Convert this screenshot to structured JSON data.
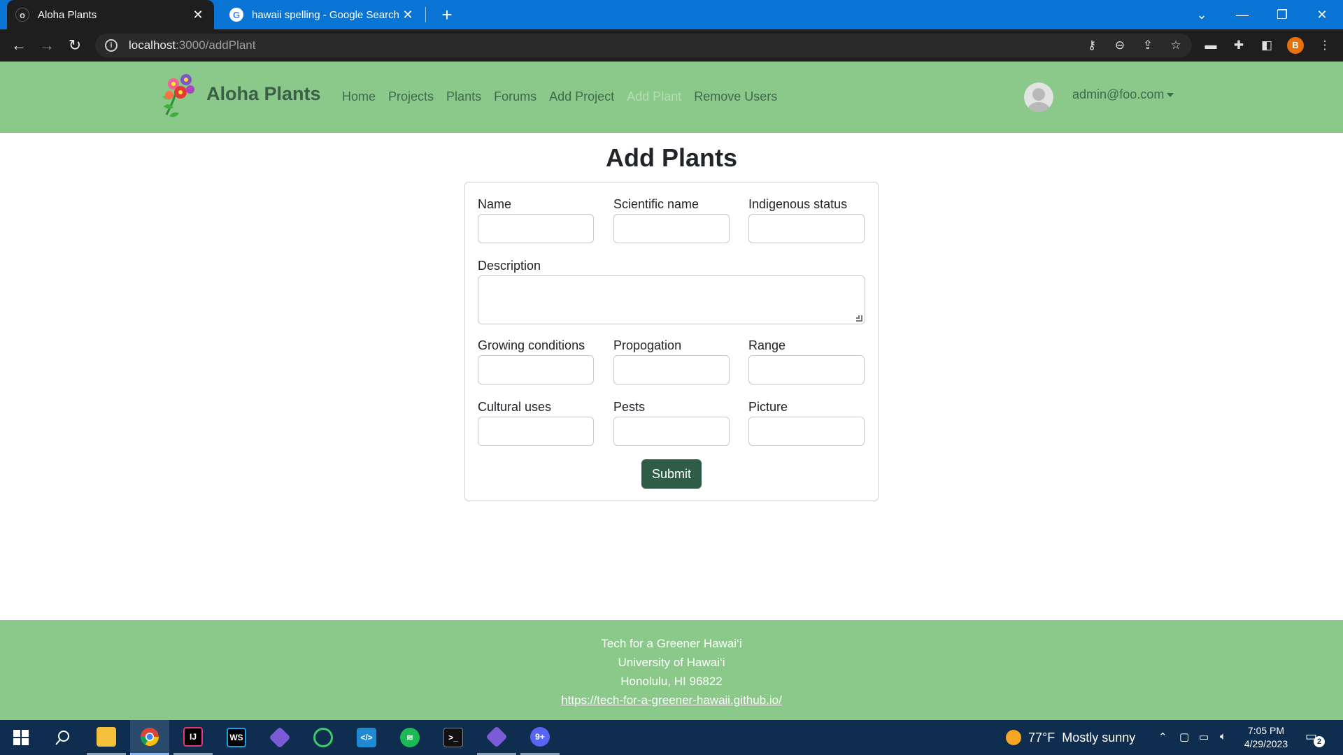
{
  "browser": {
    "tabs": [
      {
        "title": "Aloha Plants",
        "favicon": "o",
        "active": true
      },
      {
        "title": "hawaii spelling - Google Search",
        "favicon": "G",
        "active": false
      }
    ],
    "new_tab_symbol": "+",
    "url_host": "localhost",
    "url_path": ":3000/addPlant",
    "profile_initial": "B",
    "window_controls": {
      "tab_search": "⌄",
      "minimize": "—",
      "restore": "❐",
      "close": "✕"
    },
    "tab_close_symbol": "✕"
  },
  "navbar": {
    "brand": "Aloha Plants",
    "links": [
      "Home",
      "Projects",
      "Plants",
      "Forums",
      "Add Project",
      "Add Plant",
      "Remove Users"
    ],
    "active_link": "Add Plant",
    "user_email": "admin@foo.com"
  },
  "form": {
    "title": "Add Plants",
    "fields": {
      "name": "Name",
      "scientific_name": "Scientific name",
      "indigenous_status": "Indigenous status",
      "description": "Description",
      "growing_conditions": "Growing conditions",
      "propogation": "Propogation",
      "range": "Range",
      "cultural_uses": "Cultural uses",
      "pests": "Pests",
      "picture": "Picture"
    },
    "values": {
      "name": "",
      "scientific_name": "",
      "indigenous_status": "",
      "description": "",
      "growing_conditions": "",
      "propogation": "",
      "range": "",
      "cultural_uses": "",
      "pests": "",
      "picture": ""
    },
    "submit_label": "Submit"
  },
  "footer": {
    "line1": "Tech for a Greener Hawai‘i",
    "line2": "University of Hawai‘i",
    "line3": "Honolulu, HI 96822",
    "link": "https://tech-for-a-greener-hawaii.github.io/"
  },
  "taskbar": {
    "weather_temp": "77°F",
    "weather_desc": "Mostly sunny",
    "time": "7:05 PM",
    "date": "4/29/2023",
    "notification_count": "2"
  },
  "colors": {
    "browser_tabstrip": "#0a74d4",
    "browser_toolbar": "#1e1e1e",
    "site_green": "#8bc98a",
    "nav_link": "#3e6a4c",
    "submit_button": "#2f5c47",
    "taskbar": "#0e2d4f"
  }
}
